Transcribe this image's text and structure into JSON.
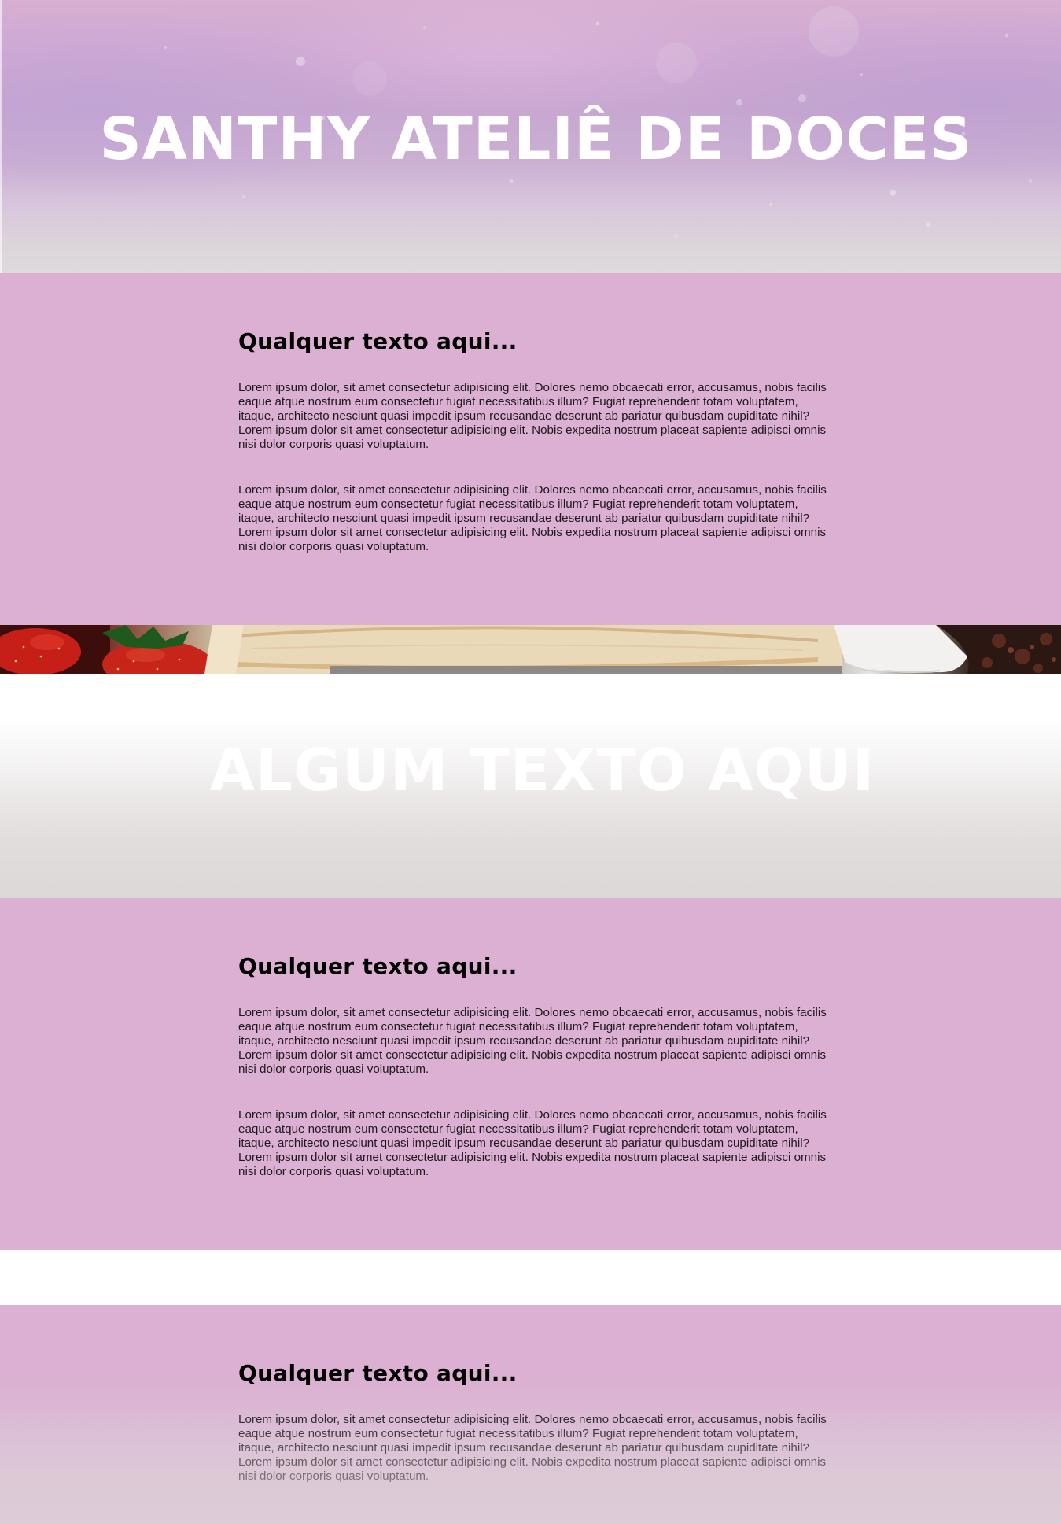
{
  "hero": {
    "title": "SANTHY ATELIÊ DE DOCES",
    "colors": {
      "top": "#d7afd2",
      "bottom": "#dedadc"
    }
  },
  "sections": [
    {
      "heading": "Qualquer texto aqui...",
      "paragraphs": [
        "Lorem ipsum dolor, sit amet consectetur adipisicing elit. Dolores nemo obcaecati error, accusamus, nobis facilis eaque atque nostrum eum consectetur fugiat necessitatibus illum? Fugiat reprehenderit totam voluptatem, itaque, architecto nesciunt quasi impedit ipsum recusandae deserunt ab pariatur quibusdam cupiditate nihil? Lorem ipsum dolor sit amet consectetur adipisicing elit. Nobis expedita nostrum placeat sapiente adipisci omnis nisi dolor corporis quasi voluptatum.",
        "Lorem ipsum dolor, sit amet consectetur adipisicing elit. Dolores nemo obcaecati error, accusamus, nobis facilis eaque atque nostrum eum consectetur fugiat necessitatibus illum? Fugiat reprehenderit totam voluptatem, itaque, architecto nesciunt quasi impedit ipsum recusandae deserunt ab pariatur quibusdam cupiditate nihil? Lorem ipsum dolor sit amet consectetur adipisicing elit. Nobis expedita nostrum placeat sapiente adipisci omnis nisi dolor corporis quasi voluptatum."
      ]
    },
    {
      "heading": "Qualquer texto aqui...",
      "paragraphs": [
        "Lorem ipsum dolor, sit amet consectetur adipisicing elit. Dolores nemo obcaecati error, accusamus, nobis facilis eaque atque nostrum eum consectetur fugiat necessitatibus illum? Fugiat reprehenderit totam voluptatem, itaque, architecto nesciunt quasi impedit ipsum recusandae deserunt ab pariatur quibusdam cupiditate nihil? Lorem ipsum dolor sit amet consectetur adipisicing elit. Nobis expedita nostrum placeat sapiente adipisci omnis nisi dolor corporis quasi voluptatum.",
        "Lorem ipsum dolor, sit amet consectetur adipisicing elit. Dolores nemo obcaecati error, accusamus, nobis facilis eaque atque nostrum eum consectetur fugiat necessitatibus illum? Fugiat reprehenderit totam voluptatem, itaque, architecto nesciunt quasi impedit ipsum recusandae deserunt ab pariatur quibusdam cupiditate nihil? Lorem ipsum dolor sit amet consectetur adipisicing elit. Nobis expedita nostrum placeat sapiente adipisci omnis nisi dolor corporis quasi voluptatum."
      ]
    },
    {
      "heading": "Qualquer texto aqui...",
      "paragraphs": [
        "Lorem ipsum dolor, sit amet consectetur adipisicing elit. Dolores nemo obcaecati error, accusamus, nobis facilis eaque atque nostrum eum consectetur fugiat necessitatibus illum? Fugiat reprehenderit totam voluptatem, itaque, architecto nesciunt quasi impedit ipsum recusandae deserunt ab pariatur quibusdam cupiditate nihil? Lorem ipsum dolor sit amet consectetur adipisicing elit. Nobis expedita nostrum placeat sapiente adipisci omnis nisi dolor corporis quasi voluptatum."
      ]
    }
  ],
  "photo_strip": {
    "subject": "strawberries, wooden board, white dish, chocolate cake",
    "colors": {
      "strawberry": "#c8201a",
      "wood": "#e9d6b4",
      "dish": "#f2f0ee",
      "chocolate": "#3a1a12"
    }
  },
  "banner_2": {
    "title": "ALGUM TEXTO AQUI"
  },
  "theme": {
    "section_bg": "#dbb0d2",
    "heading_color": "#000000",
    "text_color": "#1d1a1d"
  }
}
